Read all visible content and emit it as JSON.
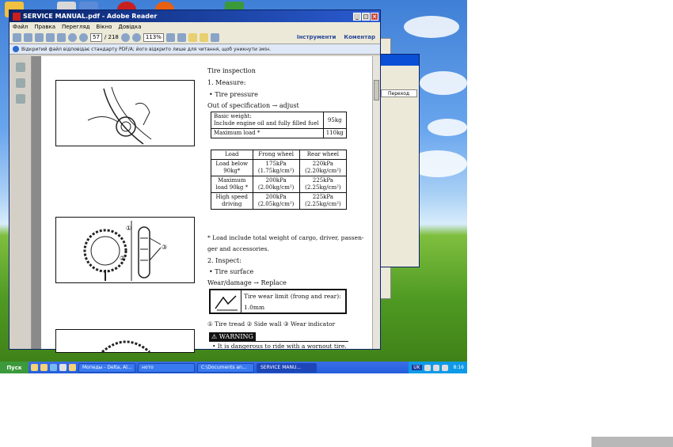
{
  "window": {
    "title": "SERVICE MANUAL.pdf - Adobe Reader",
    "controls": [
      "_",
      "□",
      "×"
    ]
  },
  "menu": [
    "Файл",
    "Правка",
    "Перегляд",
    "Вікно",
    "Довідка"
  ],
  "toolbar": {
    "page_current": "57",
    "page_total": "/ 218",
    "zoom": "113%",
    "tools_link": "Інструменти",
    "comment_link": "Коментар"
  },
  "infobar": {
    "message": "Відкритий файл відповідає стандарту PDF/A; його відкрито лише для читання, щоб уникнути змін."
  },
  "page": {
    "heading": "Tire inspection",
    "step1": "1. Measure:",
    "bullet_pressure": "•  Tire pressure",
    "out_of_spec": "Out of specification → adjust",
    "basic_weight_label_1": "Basic weight:",
    "basic_weight_label_2": "Include engine oil and fully filled fuel",
    "basic_weight_value": "95kg",
    "max_load_label": "Maximum load *",
    "max_load_value": "110kg",
    "load_table": {
      "headers": [
        "Load",
        "Frong wheel",
        "Rear wheel"
      ],
      "rows": [
        [
          "Load below 90kg*",
          "175kPa (1.75kg/cm²)",
          "220kPa (2.20kg/cm²)"
        ],
        [
          "Maximum load 90kg *",
          "200kPa (2.00kg/cm²)",
          "225kPa (2.25kg/cm²)"
        ],
        [
          "High speed driving",
          "200kPa (2.05kg/cm²)",
          "225kPa (2.25kg/cm²)"
        ]
      ]
    },
    "note_1": "* Load include total weight of cargo, driver, passen-",
    "note_2": "ger and accessories.",
    "step2": "2. Inspect:",
    "bullet_surface": "•  Tire surface",
    "wear_replace": "Wear/damage → Replace",
    "wear_limit_1": "Tire wear limit (frong and rear):",
    "wear_limit_2": "1.0mm",
    "legend": "① Tire tread  ② Side wall  ③ Wear indicator",
    "warning_label": "⚠ WARNING",
    "warning_text": "•  It is dangerous to ride with a wornout tire."
  },
  "background_window": {
    "go_button": "Переход"
  },
  "taskbar": {
    "start": "Пуск",
    "tasks": [
      "Мопеды - Delta, Al...",
      "ното",
      "C:\\Documents an...",
      "SERVICE MANU..."
    ],
    "lang": "UK",
    "clock": "8:16"
  }
}
